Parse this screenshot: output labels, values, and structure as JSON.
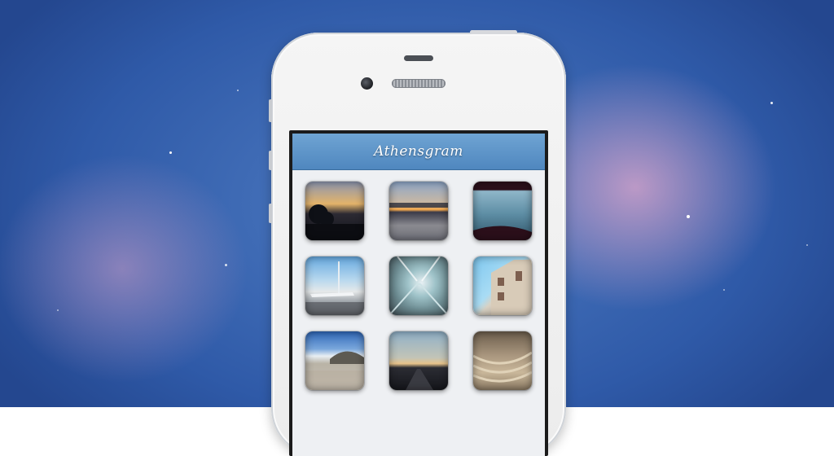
{
  "app": {
    "title": "Athensgram"
  },
  "photos": [
    {
      "name": "sunset-tree"
    },
    {
      "name": "sunset-sea"
    },
    {
      "name": "aerial-city"
    },
    {
      "name": "airport-plane"
    },
    {
      "name": "metro-tunnel"
    },
    {
      "name": "building-sky"
    },
    {
      "name": "city-view"
    },
    {
      "name": "road-dusk"
    },
    {
      "name": "ancient-theatre"
    }
  ]
}
